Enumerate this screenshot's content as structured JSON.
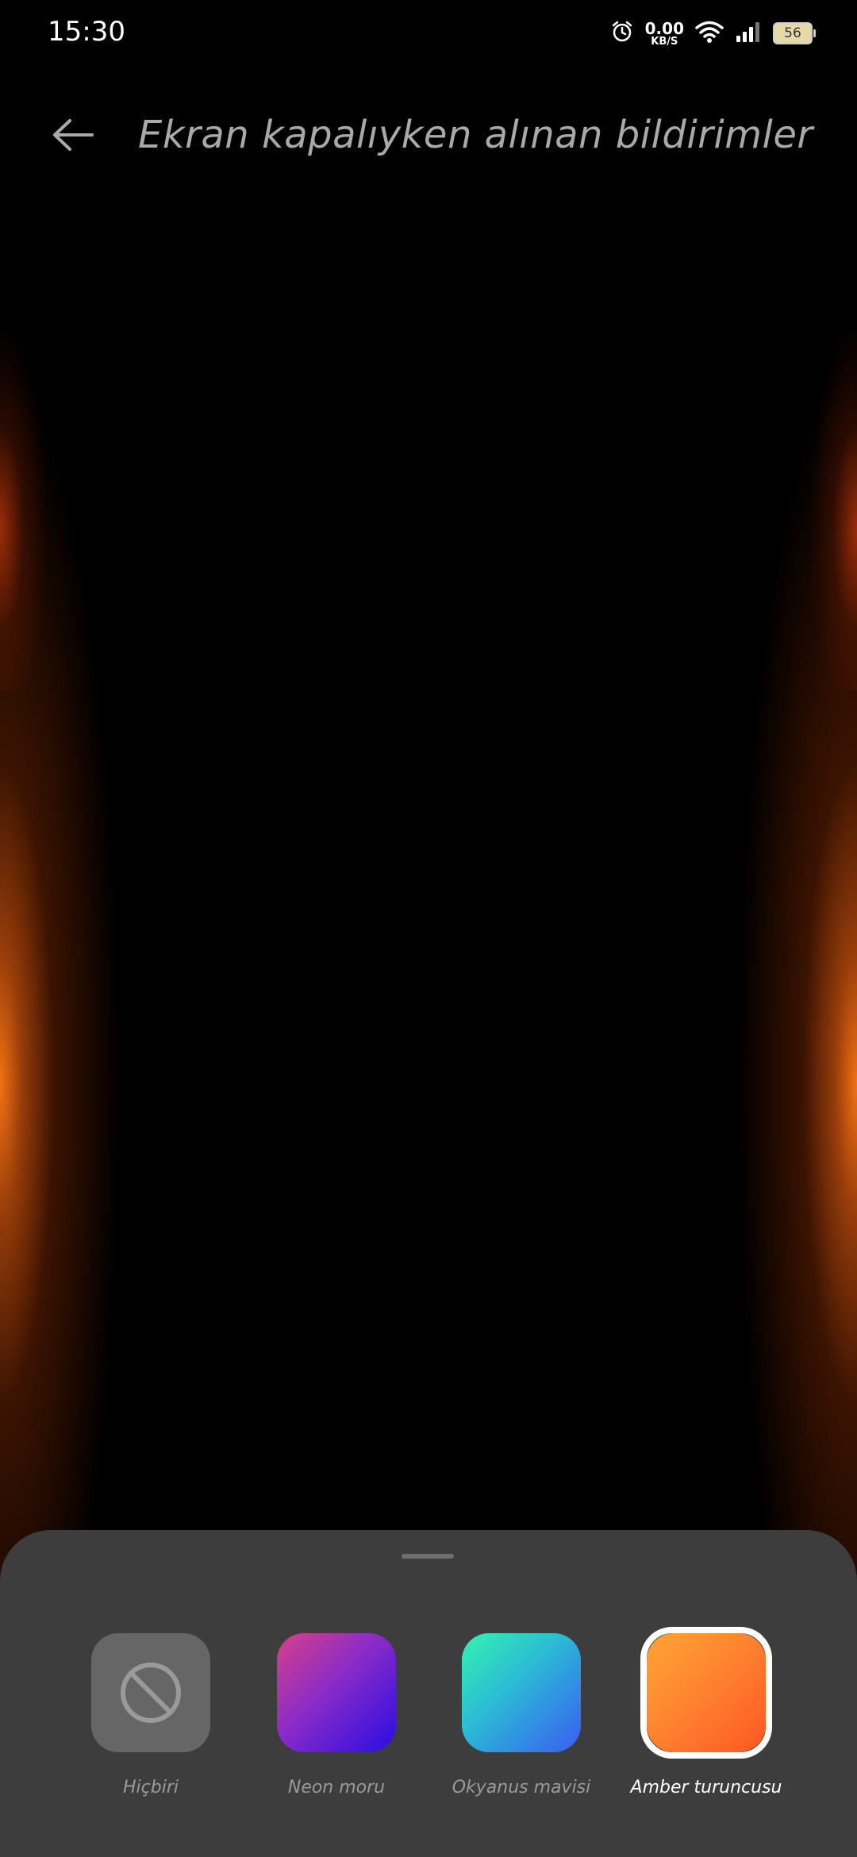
{
  "status_bar": {
    "time": "15:30",
    "net_speed_value": "0.00",
    "net_speed_unit": "KB/S",
    "battery_level": "56",
    "icons": [
      "alarm-icon",
      "wifi-icon",
      "signal-icon",
      "battery-icon"
    ]
  },
  "header": {
    "back_icon": "back-arrow-icon",
    "title": "Ekran kapalıyken alınan bildirimler"
  },
  "preview": {
    "edge_glow_color": "#ff7a1a"
  },
  "sheet": {
    "options": [
      {
        "label": "Hiçbiri",
        "icon": "no-symbol-icon",
        "colors": [
          "#666666"
        ],
        "selected": false
      },
      {
        "label": "Neon moru",
        "colors": [
          "#d64089",
          "#2a0ce3"
        ],
        "selected": false
      },
      {
        "label": "Okyanus mavisi",
        "colors": [
          "#34f3b2",
          "#3a5cf2"
        ],
        "selected": false
      },
      {
        "label": "Amber turuncusu",
        "colors": [
          "#ffa534",
          "#ff5722"
        ],
        "selected": true
      }
    ]
  }
}
